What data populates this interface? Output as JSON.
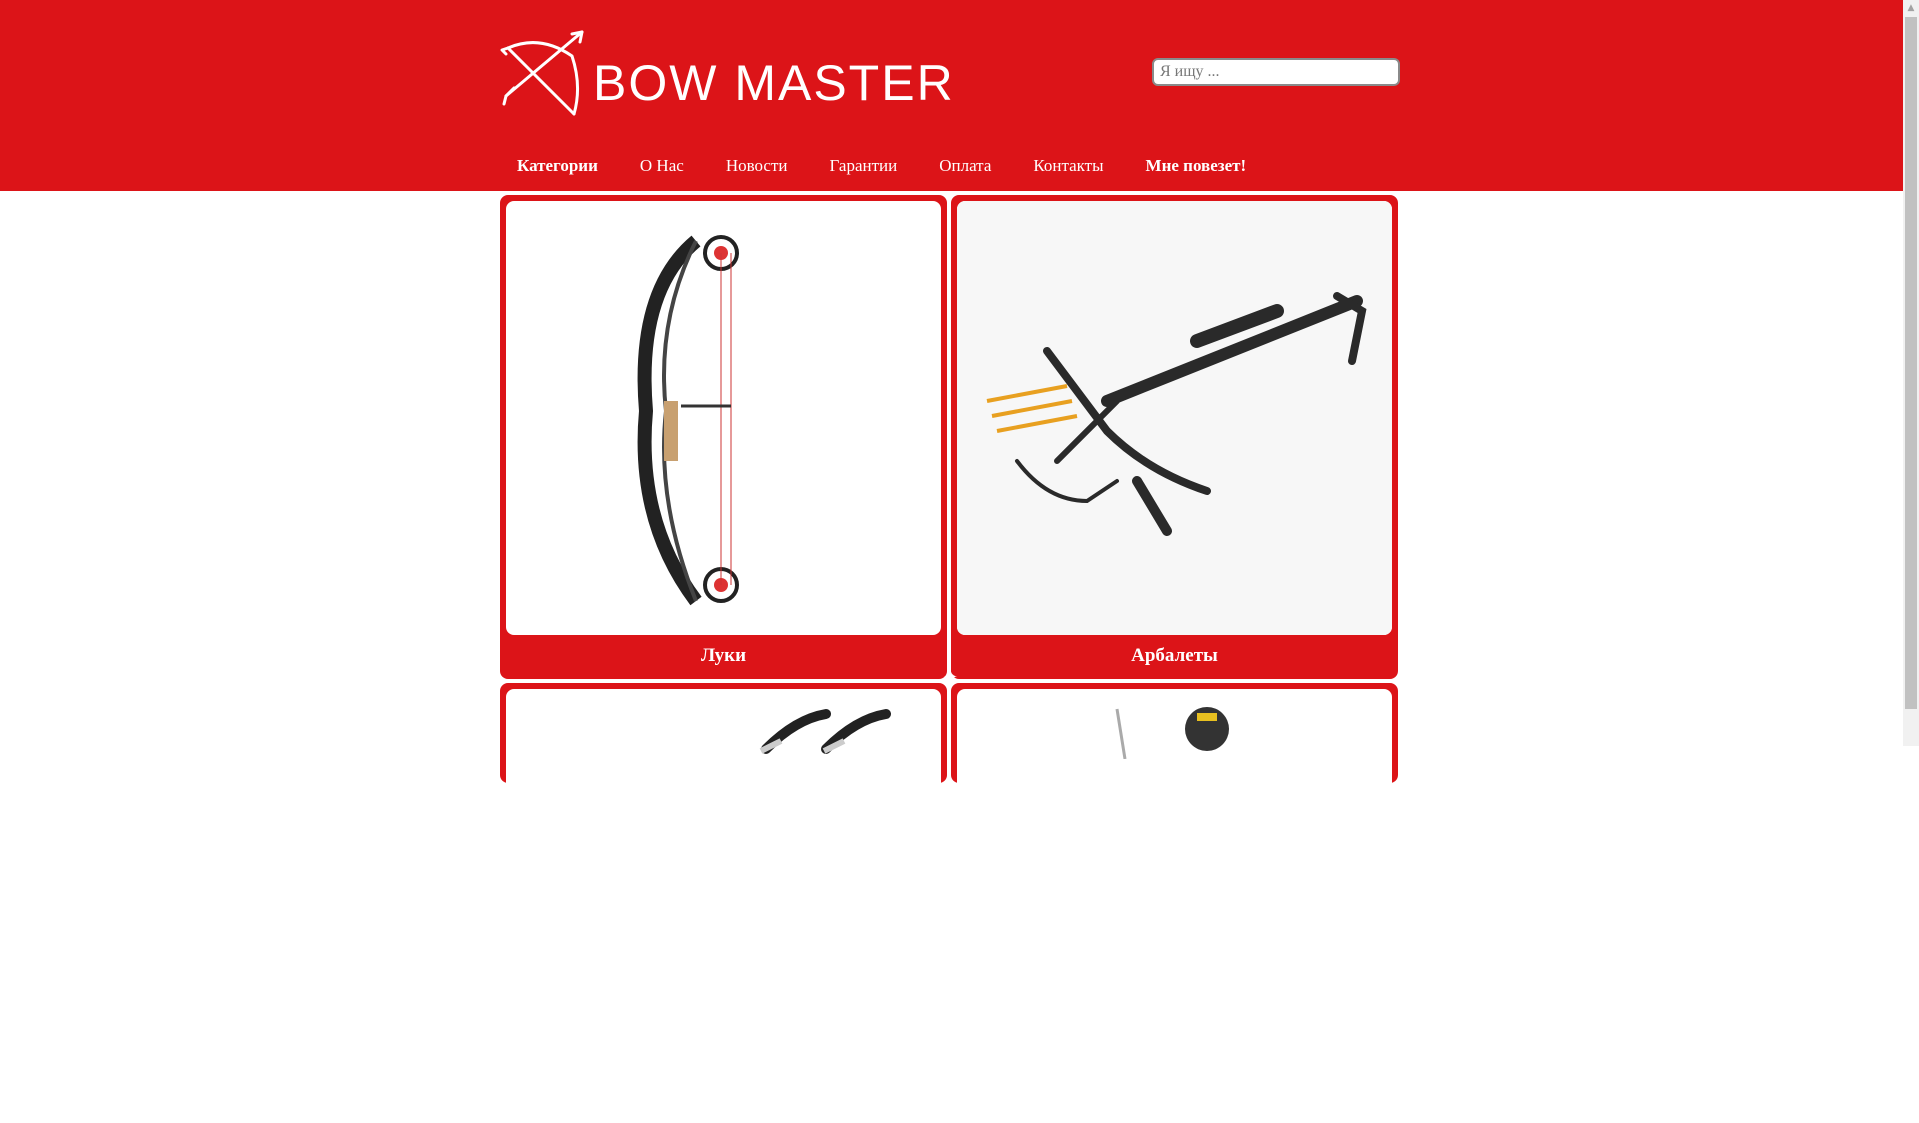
{
  "header": {
    "logo_text": "BOW MASTER",
    "search_placeholder": "Я ищу ...",
    "brand_color": "#dc1418"
  },
  "nav": {
    "items": [
      {
        "label": "Категории"
      },
      {
        "label": "О Нас"
      },
      {
        "label": "Новости"
      },
      {
        "label": "Гарантии"
      },
      {
        "label": "Оплата"
      },
      {
        "label": "Контакты"
      },
      {
        "label": "Мне повезет!"
      }
    ]
  },
  "categories": [
    {
      "label": "Луки",
      "icon": "compound-bow-image"
    },
    {
      "label": "Арбалеты",
      "icon": "crossbow-image"
    },
    {
      "label": "",
      "icon": "arrows-image"
    },
    {
      "label": "",
      "icon": "accessories-image"
    }
  ]
}
